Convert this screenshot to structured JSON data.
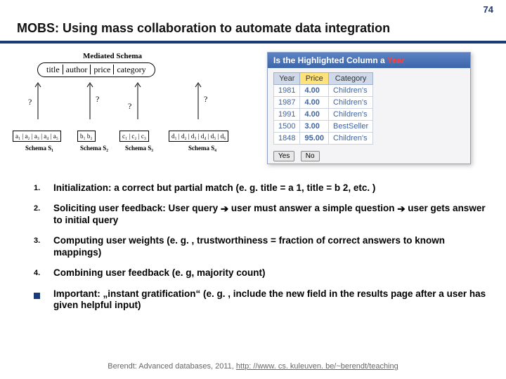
{
  "page_number": "74",
  "title": "MOBS: Using mass collaboration to automate data integration",
  "diagram": {
    "mediated_label": "Mediated Schema",
    "mediated_cols": [
      "title",
      "author",
      "price",
      "category"
    ],
    "question_mark": "?",
    "schemas": [
      {
        "cols": "a₁ | a₂ | a₃ | a₄ | a₅",
        "label": "Schema S₁"
      },
      {
        "cols": "b₁  b₂",
        "label": "Schema S₂"
      },
      {
        "cols": "c₁ | c₂ | c₃",
        "label": "Schema S₃"
      },
      {
        "cols": "d₁ | d₂ | d₃ | d₄ | d₅ | d₆",
        "label": "Schema S₄"
      }
    ]
  },
  "panel": {
    "question_prefix": "Is the Highlighted Column a ",
    "question_highlight": "Year",
    "headers": [
      "Year",
      "Price",
      "Category"
    ],
    "rows": [
      [
        "1981",
        "4.00",
        "Children's"
      ],
      {
        "0": "1987",
        "1": "4.00",
        "2": "Children's"
      },
      {
        "0": "1991",
        "1": "4.00",
        "2": "Children's"
      },
      {
        "0": "1500",
        "1": "3.00",
        "2": "BestSeller"
      },
      {
        "0": "1848",
        "1": "95.00",
        "2": "Children's"
      }
    ],
    "yes": "Yes",
    "no": "No"
  },
  "items": [
    {
      "m": "1.",
      "t": "Initialization: a correct but partial match (e. g. title = a 1, title = b 2, etc. )"
    },
    {
      "m": "2.",
      "t_parts": [
        "Soliciting user feedback: User query ",
        " user must answer a simple question ",
        " user gets answer to initial query"
      ]
    },
    {
      "m": "3.",
      "t": "Computing user weights (e. g. , trustworthiness = fraction of correct answers to known mappings)"
    },
    {
      "m": "4.",
      "t": "Combining user feedback (e. g, majority count)"
    },
    {
      "m": "sq",
      "t": "Important: „instant gratification“ (e. g. , include the new field in the results page after a user has given helpful input)"
    }
  ],
  "footer": {
    "prefix": "Berendt: Advanced databases, 2011, ",
    "link": "http: //www. cs. kuleuven. be/~berendt/teaching"
  },
  "arrow_glyph": "➔"
}
